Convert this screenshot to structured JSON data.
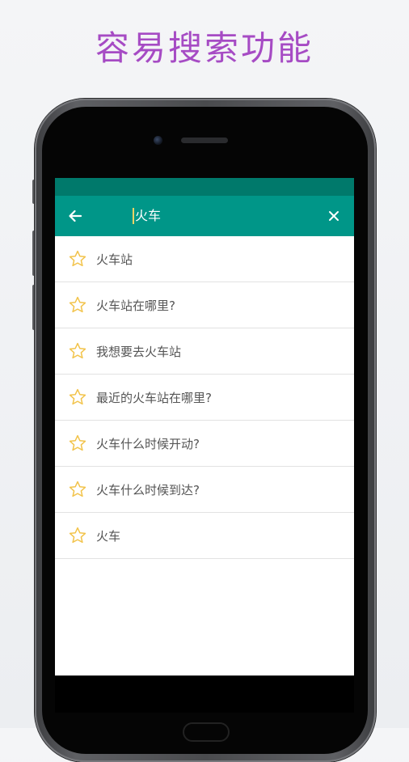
{
  "headline": "容易搜索功能",
  "colors": {
    "headline": "#a64bc4",
    "status_bar": "#00796b",
    "toolbar": "#009688",
    "star_outline": "#f2c34a",
    "caret": "#f6d365"
  },
  "toolbar": {
    "back_icon": "arrow-left-icon",
    "search_value": "火车",
    "clear_icon": "close-icon"
  },
  "results": [
    {
      "label": "火车站",
      "icon": "star-outline-icon"
    },
    {
      "label": "火车站在哪里?",
      "icon": "star-outline-icon"
    },
    {
      "label": "我想要去火车站",
      "icon": "star-outline-icon"
    },
    {
      "label": "最近的火车站在哪里?",
      "icon": "star-outline-icon"
    },
    {
      "label": "火车什么时候开动?",
      "icon": "star-outline-icon"
    },
    {
      "label": "火车什么时候到达?",
      "icon": "star-outline-icon"
    },
    {
      "label": "火车",
      "icon": "star-outline-icon"
    }
  ]
}
